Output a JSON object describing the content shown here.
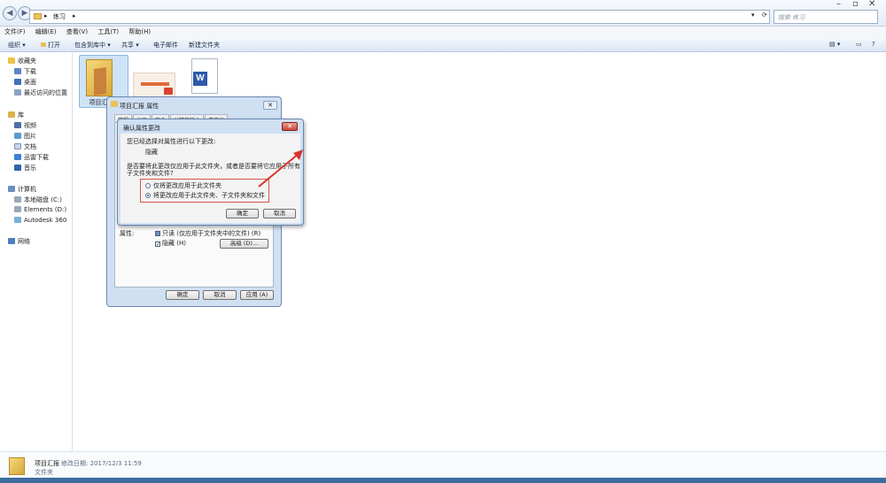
{
  "address": {
    "crumbs": [
      "▸",
      "练习",
      "▸"
    ],
    "search_placeholder": "搜索 练习"
  },
  "menu": [
    "文件(F)",
    "编辑(E)",
    "查看(V)",
    "工具(T)",
    "帮助(H)"
  ],
  "toolbar": {
    "organize": "组织 ▾",
    "open": "打开",
    "include_library": "包含到库中 ▾",
    "share": "共享 ▾",
    "email": "电子邮件",
    "new_folder": "新建文件夹"
  },
  "sidebar": {
    "favorites": "收藏夹",
    "fav_items": [
      "下载",
      "桌面",
      "最近访问的位置"
    ],
    "library": "库",
    "lib_items": [
      "视频",
      "图片",
      "文档",
      "迅雷下载",
      "音乐"
    ],
    "computer": "计算机",
    "comp_items": [
      "本地磁盘 (C:)",
      "Elements (D:)",
      "Autodesk 360"
    ],
    "network": "网络"
  },
  "files": {
    "folder_label": "项目汇"
  },
  "props_dialog": {
    "title": "项目汇报 属性",
    "tabs": [
      "常规",
      "共享",
      "安全",
      "以前的版本",
      "自定义"
    ],
    "attributes_label": "属性:",
    "readonly_label": "只读 (仅应用于文件夹中的文件) (R)",
    "hidden_label": "隐藏 (H)",
    "advanced_btn": "高级 (D)...",
    "ok": "确定",
    "cancel": "取消",
    "apply": "应用 (A)"
  },
  "confirm_dialog": {
    "title": "确认属性更改",
    "line1": "您已经选择对属性进行以下更改:",
    "change": "隐藏",
    "question": "是否要将此更改仅应用于此文件夹，或者是否要将它应用于所有子文件夹和文件?",
    "option1": "仅将更改应用于此文件夹",
    "option2": "将更改应用于此文件夹、子文件夹和文件",
    "selected": 2,
    "ok": "确定",
    "cancel": "取消"
  },
  "details": {
    "name": "项目汇报",
    "modified": "修改日期: 2017/12/3 11:59",
    "type": "文件夹"
  },
  "colors": {
    "highlight_border": "#d9534a",
    "arrow": "#d9342b"
  }
}
